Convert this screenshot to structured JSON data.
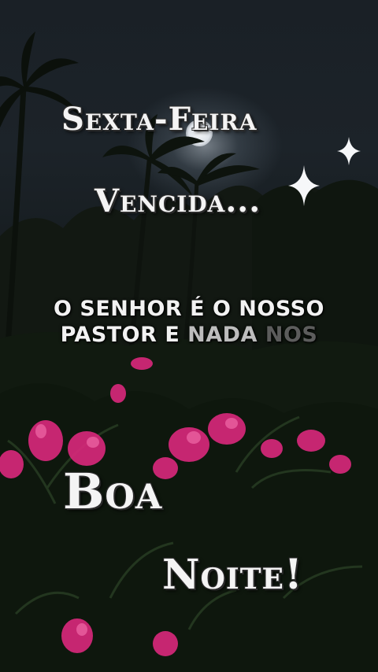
{
  "heading": {
    "line1": "Sexta-Feira",
    "line2": "Vencida..."
  },
  "verse": {
    "line1": "O SENHOR É O NOSSO",
    "line2_solid": "PASTOR E ",
    "line2_fade1": "NADA ",
    "line2_fade2": "NOS"
  },
  "greeting": {
    "word1": "Boa",
    "word2": "Noite!"
  },
  "icons": [
    "sparkle-icon",
    "sparkle-icon"
  ],
  "colors": {
    "text": "#f4f4f4",
    "outline": "#2b2b2b",
    "flower": "#d6287a"
  }
}
